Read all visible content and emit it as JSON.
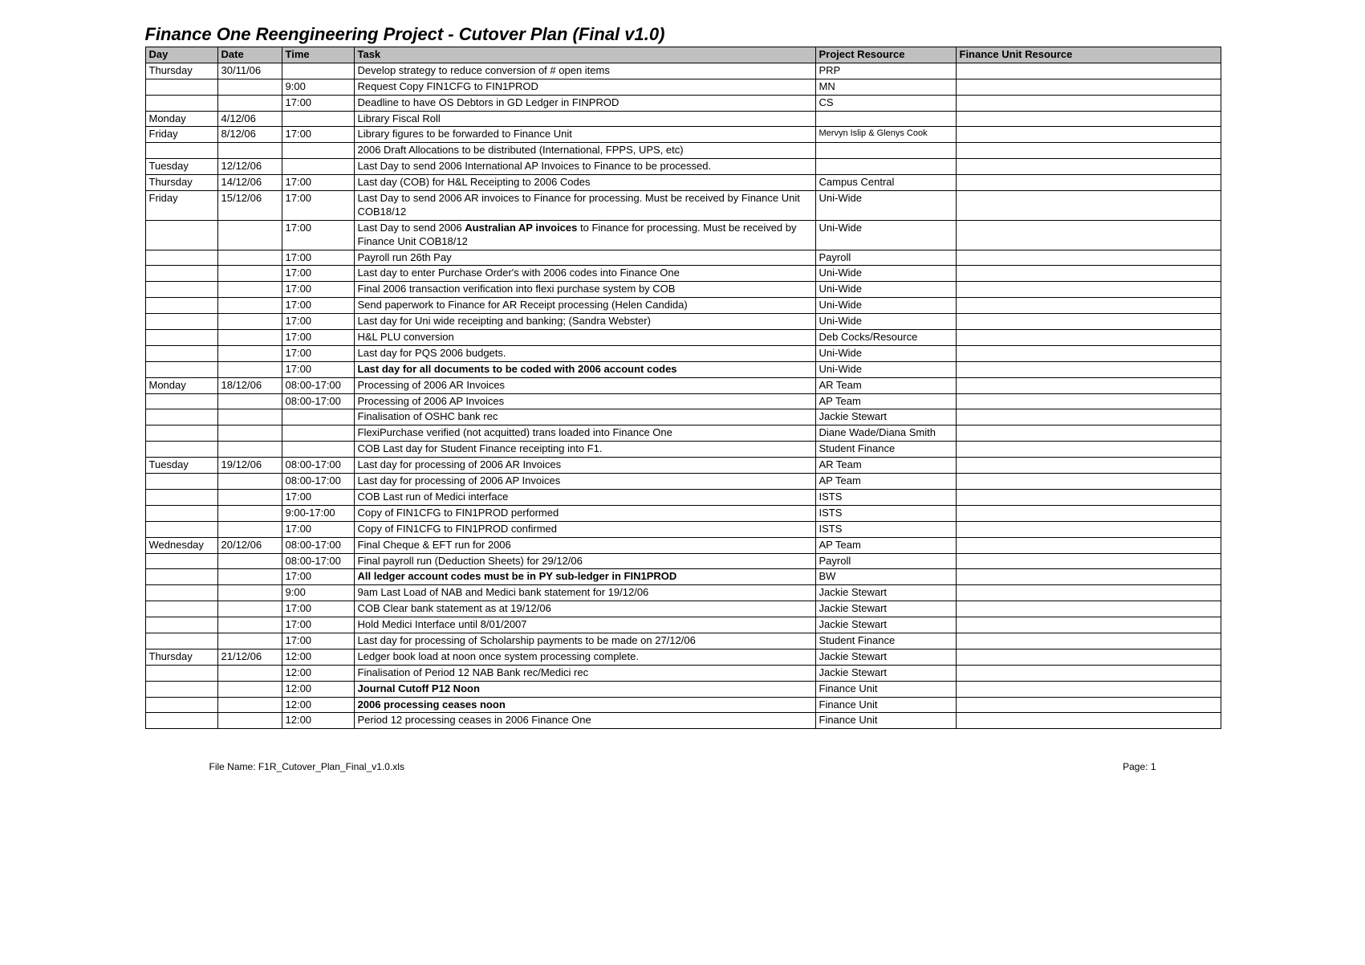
{
  "title": "Finance One Reengineering Project - Cutover Plan (Final v1.0)",
  "columns": [
    "Day",
    "Date",
    "Time",
    "Task",
    "Project Resource",
    "Finance Unit Resource"
  ],
  "rows": [
    {
      "day": "Thursday",
      "date": "30/11/06",
      "time": "",
      "task": "Develop strategy to reduce conversion of # open items",
      "r1": "PRP",
      "r2": ""
    },
    {
      "day": "",
      "date": "",
      "time": "9:00",
      "task": "Request Copy FIN1CFG to FIN1PROD",
      "r1": "MN",
      "r2": ""
    },
    {
      "day": "",
      "date": "",
      "time": "17:00",
      "task": "Deadline to have OS Debtors in GD Ledger in FINPROD",
      "r1": "CS",
      "r2": ""
    },
    {
      "day": "Monday",
      "date": "4/12/06",
      "time": "",
      "task": "Library Fiscal Roll",
      "r1": "",
      "r2": ""
    },
    {
      "day": "Friday",
      "date": "8/12/06",
      "time": "17:00",
      "task": "Library figures to be forwarded to Finance Unit",
      "r1": "Mervyn Islip & Glenys Cook",
      "r2": ""
    },
    {
      "day": "",
      "date": "",
      "time": "",
      "task": "2006 Draft Allocations to be distributed (International, FPPS, UPS, etc)",
      "r1": "",
      "r2": ""
    },
    {
      "day": "Tuesday",
      "date": "12/12/06",
      "time": "",
      "task": "Last Day to send 2006 International AP Invoices to Finance to be processed.",
      "r1": "",
      "r2": ""
    },
    {
      "day": "Thursday",
      "date": "14/12/06",
      "time": "17:00",
      "task": "Last day (COB) for H&L Receipting to 2006 Codes",
      "r1": "Campus Central",
      "r2": ""
    },
    {
      "day": "Friday",
      "date": "15/12/06",
      "time": "17:00",
      "task": "Last Day to send 2006 AR invoices to Finance for processing. Must be received by Finance Unit COB18/12",
      "r1": "Uni-Wide",
      "r2": ""
    },
    {
      "day": "",
      "date": "",
      "time": "17:00",
      "task_html": "Last Day to send 2006 <b>Australian AP invoices</b> to Finance for processing. Must be received by Finance Unit COB18/12",
      "r1": "Uni-Wide",
      "r2": ""
    },
    {
      "day": "",
      "date": "",
      "time": "17:00",
      "task": "Payroll run 26th Pay",
      "r1": "Payroll",
      "r2": ""
    },
    {
      "day": "",
      "date": "",
      "time": "17:00",
      "task": "Last day to enter Purchase Order's with 2006 codes into Finance One",
      "r1": "Uni-Wide",
      "r2": ""
    },
    {
      "day": "",
      "date": "",
      "time": "17:00",
      "task": "Final 2006 transaction verification into flexi purchase system by COB",
      "r1": "Uni-Wide",
      "r2": ""
    },
    {
      "day": "",
      "date": "",
      "time": "17:00",
      "task": "Send paperwork to Finance for AR Receipt processing (Helen Candida)",
      "r1": "Uni-Wide",
      "r2": ""
    },
    {
      "day": "",
      "date": "",
      "time": "17:00",
      "task": "Last day for Uni wide receipting and banking; (Sandra Webster)",
      "r1": "Uni-Wide",
      "r2": ""
    },
    {
      "day": "",
      "date": "",
      "time": "17:00",
      "task": "H&L PLU conversion",
      "r1": "Deb Cocks/Resource",
      "r2": ""
    },
    {
      "day": "",
      "date": "",
      "time": "17:00",
      "task": "Last day for PQS 2006 budgets.",
      "r1": "Uni-Wide",
      "r2": ""
    },
    {
      "day": "",
      "date": "",
      "time": "17:00",
      "task": "Last day for all documents to be coded with 2006 account codes",
      "bold": true,
      "r1": "Uni-Wide",
      "r2": ""
    },
    {
      "day": "Monday",
      "date": "18/12/06",
      "time": "08:00-17:00",
      "task": "Processing of 2006 AR Invoices",
      "r1": "AR Team",
      "r2": ""
    },
    {
      "day": "",
      "date": "",
      "time": "08:00-17:00",
      "task": "Processing of 2006 AP Invoices",
      "r1": "AP Team",
      "r2": ""
    },
    {
      "day": "",
      "date": "",
      "time": "",
      "task": "Finalisation of OSHC bank rec",
      "r1": "Jackie Stewart",
      "r2": ""
    },
    {
      "day": "",
      "date": "",
      "time": "",
      "task": "FlexiPurchase verified (not acquitted) trans loaded into Finance One",
      "r1": "Diane Wade/Diana Smith",
      "r2": ""
    },
    {
      "day": "",
      "date": "",
      "time": "",
      "task": "COB Last day for Student Finance receipting into F1.",
      "r1": "Student Finance",
      "r2": ""
    },
    {
      "day": "Tuesday",
      "date": "19/12/06",
      "time": "08:00-17:00",
      "task": "Last day for processing of 2006 AR Invoices",
      "r1": "AR Team",
      "r2": ""
    },
    {
      "day": "",
      "date": "",
      "time": "08:00-17:00",
      "task": "Last day for processing of 2006 AP Invoices",
      "r1": "AP Team",
      "r2": ""
    },
    {
      "day": "",
      "date": "",
      "time": "17:00",
      "task": "COB Last run of Medici interface",
      "r1": "ISTS",
      "r2": ""
    },
    {
      "day": "",
      "date": "",
      "time": "9:00-17:00",
      "task": "Copy of FIN1CFG to FIN1PROD performed",
      "r1": "ISTS",
      "r2": ""
    },
    {
      "day": "",
      "date": "",
      "time": "17:00",
      "task": "Copy of FIN1CFG to FIN1PROD confirmed",
      "r1": "ISTS",
      "r2": ""
    },
    {
      "day": "Wednesday",
      "date": "20/12/06",
      "time": "08:00-17:00",
      "task": "Final Cheque & EFT run for 2006",
      "r1": "AP Team",
      "r2": ""
    },
    {
      "day": "",
      "date": "",
      "time": "08:00-17:00",
      "task": "Final payroll run (Deduction Sheets) for 29/12/06",
      "r1": "Payroll",
      "r2": ""
    },
    {
      "day": "",
      "date": "",
      "time": "17:00",
      "task": "All ledger account codes must be in PY sub-ledger in FIN1PROD",
      "bold": true,
      "r1": "BW",
      "r2": ""
    },
    {
      "day": "",
      "date": "",
      "time": "9:00",
      "task": "9am Last Load of NAB and Medici bank statement for 19/12/06",
      "r1": "Jackie Stewart",
      "r2": ""
    },
    {
      "day": "",
      "date": "",
      "time": "17:00",
      "task": "COB Clear bank statement as at 19/12/06",
      "r1": "Jackie Stewart",
      "r2": ""
    },
    {
      "day": "",
      "date": "",
      "time": "17:00",
      "task": "Hold Medici Interface until 8/01/2007",
      "r1": "Jackie Stewart",
      "r2": ""
    },
    {
      "day": "",
      "date": "",
      "time": "17:00",
      "task": "Last day for processing of Scholarship payments to be made on 27/12/06",
      "r1": "Student Finance",
      "r2": ""
    },
    {
      "day": "Thursday",
      "date": "21/12/06",
      "time": "12:00",
      "task": "Ledger book load at noon once system processing complete.",
      "r1": "Jackie Stewart",
      "r2": ""
    },
    {
      "day": "",
      "date": "",
      "time": "12:00",
      "task": "Finalisation of Period 12 NAB Bank rec/Medici rec",
      "r1": "Jackie Stewart",
      "r2": ""
    },
    {
      "day": "",
      "date": "",
      "time": "12:00",
      "task": "Journal Cutoff P12 Noon",
      "bold": true,
      "r1": "Finance Unit",
      "r2": ""
    },
    {
      "day": "",
      "date": "",
      "time": "12:00",
      "task": "2006 processing ceases noon",
      "bold": true,
      "r1": "Finance Unit",
      "r2": ""
    },
    {
      "day": "",
      "date": "",
      "time": "12:00",
      "task": "Period 12  processing ceases in 2006 Finance One",
      "r1": "Finance Unit",
      "r2": ""
    }
  ],
  "footer": {
    "file": "File Name: F1R_Cutover_Plan_Final_v1.0.xls",
    "page": "Page: 1"
  }
}
